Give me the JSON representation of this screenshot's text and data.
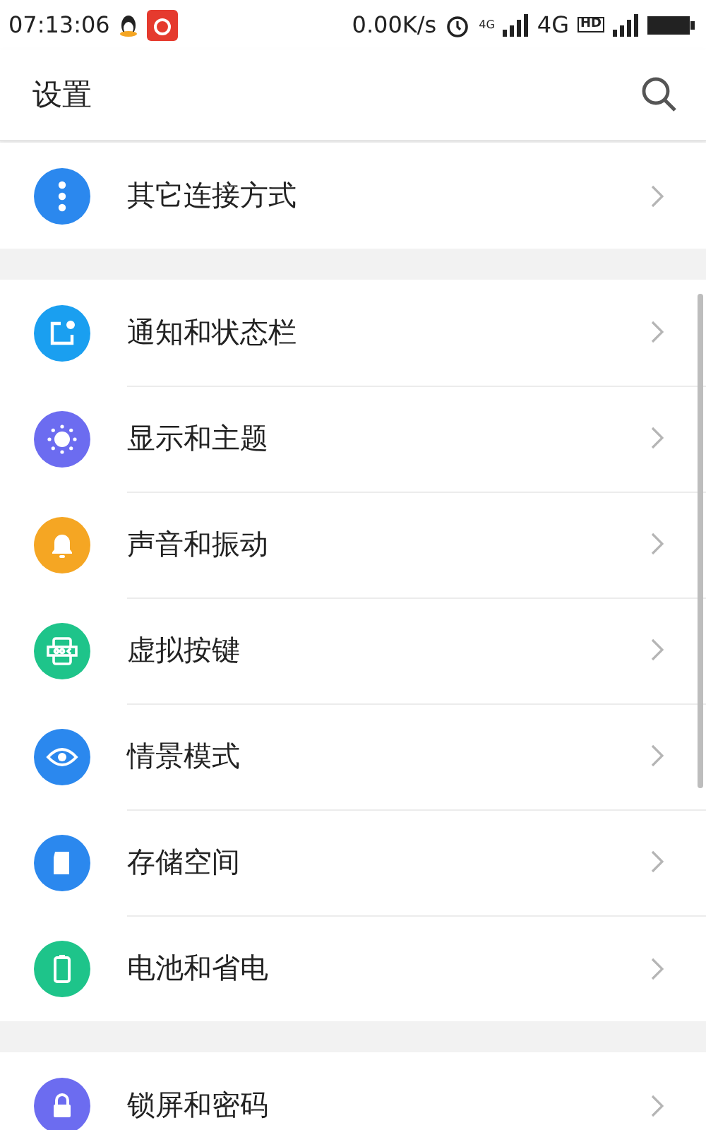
{
  "status_bar": {
    "time": "07:13:06",
    "speed": "0.00K/s",
    "net_small": "4G",
    "net": "4G",
    "hd": "HD"
  },
  "header": {
    "title": "设置"
  },
  "groups": [
    {
      "items": [
        {
          "label": "其它连接方式",
          "kind": "more",
          "color": "#2b88ee"
        }
      ]
    },
    {
      "items": [
        {
          "label": "通知和状态栏",
          "kind": "notify",
          "color": "#1a9ff0"
        },
        {
          "label": "显示和主题",
          "kind": "display",
          "color": "#6c6cf0"
        },
        {
          "label": "声音和振动",
          "kind": "bell",
          "color": "#f5a623"
        },
        {
          "label": "虚拟按键",
          "kind": "keys",
          "color": "#1ec48a"
        },
        {
          "label": "情景模式",
          "kind": "eye",
          "color": "#2b88ee"
        },
        {
          "label": "存储空间",
          "kind": "sd",
          "color": "#2b88ee"
        },
        {
          "label": "电池和省电",
          "kind": "battery",
          "color": "#1ec48a"
        }
      ]
    },
    {
      "items": [
        {
          "label": "锁屏和密码",
          "kind": "lock",
          "color": "#6c6cf0"
        }
      ]
    }
  ]
}
